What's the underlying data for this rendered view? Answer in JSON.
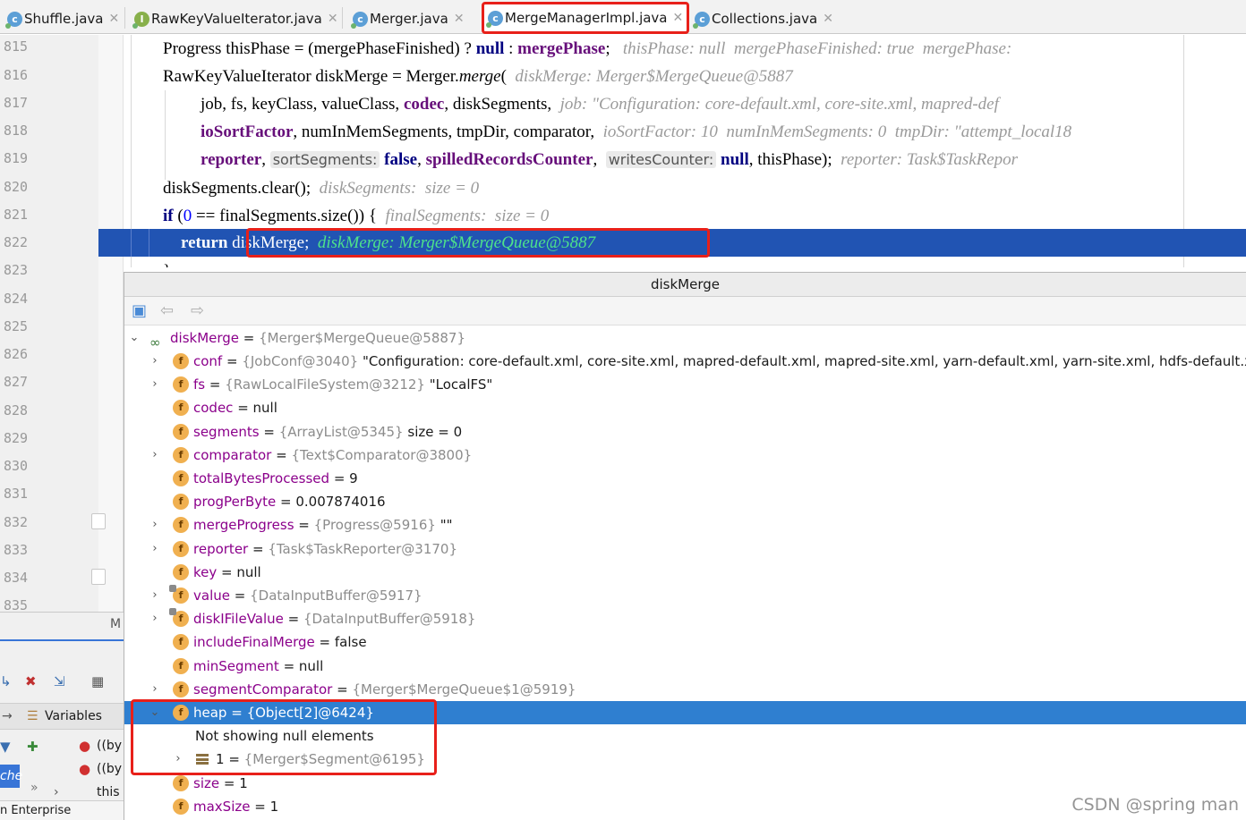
{
  "tabs": [
    {
      "label": "Shuffle.java",
      "icon": "class-icon"
    },
    {
      "label": "RawKeyValueIterator.java",
      "icon": "interface-icon"
    },
    {
      "label": "Merger.java",
      "icon": "class-icon"
    },
    {
      "label": "MergeManagerImpl.java",
      "icon": "class-icon",
      "active": true
    },
    {
      "label": "Collections.java",
      "icon": "class-icon"
    }
  ],
  "line_numbers": [
    "815",
    "816",
    "817",
    "818",
    "819",
    "820",
    "821",
    "822",
    "823",
    "824",
    "825",
    "826",
    "827",
    "828",
    "829",
    "830",
    "831",
    "832",
    "833",
    "834",
    "835"
  ],
  "code": {
    "l815_a": "Progress thisPhase = (mergePhaseFinished) ? ",
    "l815_null": "null",
    "l815_b": " : ",
    "l815_field": "mergePhase",
    "l815_c": ";",
    "l815_hint": "thisPhase: null  mergePhaseFinished: true  mergePhase: ",
    "l816_a": "RawKeyValueIterator diskMerge = Merger.",
    "l816_method": "merge",
    "l816_b": "(",
    "l816_hint": "diskMerge: Merger$MergeQueue@5887",
    "l817_a": "job, fs, keyClass, valueClass, ",
    "l817_field": "codec",
    "l817_b": ", diskSegments,",
    "l817_hint": "job: \"Configuration: core-default.xml, core-site.xml, mapred-def",
    "l818_field": "ioSortFactor",
    "l818_a": ", numInMemSegments, tmpDir, comparator,",
    "l818_hint": "ioSortFactor: 10  numInMemSegments: 0  tmpDir: \"attempt_local18",
    "l819_field": "reporter",
    "l819_a": ",",
    "l819_pill1": "sortSegments:",
    "l819_false": "false",
    "l819_b": ",",
    "l819_field2": "spilledRecordsCounter",
    "l819_c": ",",
    "l819_pill2": "writesCounter:",
    "l819_null": "null",
    "l819_d": ", thisPhase);",
    "l819_hint": "reporter: Task$TaskRepor",
    "l820_a": "diskSegments.clear();",
    "l820_hint": "diskSegments:  size = 0",
    "l821_if": "if",
    "l821_a": " (",
    "l821_zero": "0",
    "l821_b": " == finalSegments.size()) {",
    "l821_hint": "finalSegments:  size = 0",
    "l822_return": "return",
    "l822_a": " diskMerge;",
    "l822_hint": "diskMerge: Merger$MergeQueue@5887",
    "l823_a": "}"
  },
  "left_panel": {
    "m_label": "M",
    "variables_label": "Variables",
    "item1": "((by",
    "item2": "((by",
    "item3": "this",
    "cache_label": "che",
    "enterprise_label": "n Enterprise"
  },
  "popup": {
    "title": "diskMerge",
    "root": {
      "name": "diskMerge",
      "ref": "{Merger$MergeQueue@5887}"
    },
    "fields": [
      {
        "name": "conf",
        "ref": "{JobConf@3040}",
        "value": "\"Configuration: core-default.xml, core-site.xml, mapred-default.xml, mapred-site.xml, yarn-default.xml, yarn-site.xml, hdfs-default.xml, hdfs",
        "expandable": true
      },
      {
        "name": "fs",
        "ref": "{RawLocalFileSystem@3212}",
        "value": "\"LocalFS\"",
        "expandable": true
      },
      {
        "name": "codec",
        "ref": "",
        "value": "null",
        "expandable": false
      },
      {
        "name": "segments",
        "ref": "{ArrayList@5345}",
        "value": "size = 0",
        "expandable": false
      },
      {
        "name": "comparator",
        "ref": "{Text$Comparator@3800}",
        "value": "",
        "expandable": true
      },
      {
        "name": "totalBytesProcessed",
        "ref": "",
        "value": "9",
        "expandable": false
      },
      {
        "name": "progPerByte",
        "ref": "",
        "value": "0.007874016",
        "expandable": false
      },
      {
        "name": "mergeProgress",
        "ref": "{Progress@5916}",
        "value": "\"\"",
        "expandable": true
      },
      {
        "name": "reporter",
        "ref": "{Task$TaskReporter@3170}",
        "value": "",
        "expandable": true
      },
      {
        "name": "key",
        "ref": "",
        "value": "null",
        "expandable": false
      },
      {
        "name": "value",
        "ref": "{DataInputBuffer@5917}",
        "value": "",
        "expandable": true
      },
      {
        "name": "diskIFileValue",
        "ref": "{DataInputBuffer@5918}",
        "value": "",
        "expandable": true
      },
      {
        "name": "includeFinalMerge",
        "ref": "",
        "value": "false",
        "expandable": false
      },
      {
        "name": "minSegment",
        "ref": "",
        "value": "null",
        "expandable": false
      },
      {
        "name": "segmentComparator",
        "ref": "{Merger$MergeQueue$1@5919}",
        "value": "",
        "expandable": true
      },
      {
        "name": "heap",
        "ref": "{Object[2]@6424}",
        "value": "",
        "expandable": true
      },
      {
        "name": "size",
        "ref": "",
        "value": "1",
        "expandable": false
      },
      {
        "name": "maxSize",
        "ref": "",
        "value": "1",
        "expandable": false
      }
    ],
    "heap_note": "Not showing null elements",
    "heap_child": {
      "name": "1",
      "ref": "{Merger$Segment@6195}"
    }
  },
  "watermark": "CSDN @spring man",
  "colors": {
    "accent": "#2154b3",
    "highlight": "#e8201a",
    "selection": "#2f7fd0"
  }
}
